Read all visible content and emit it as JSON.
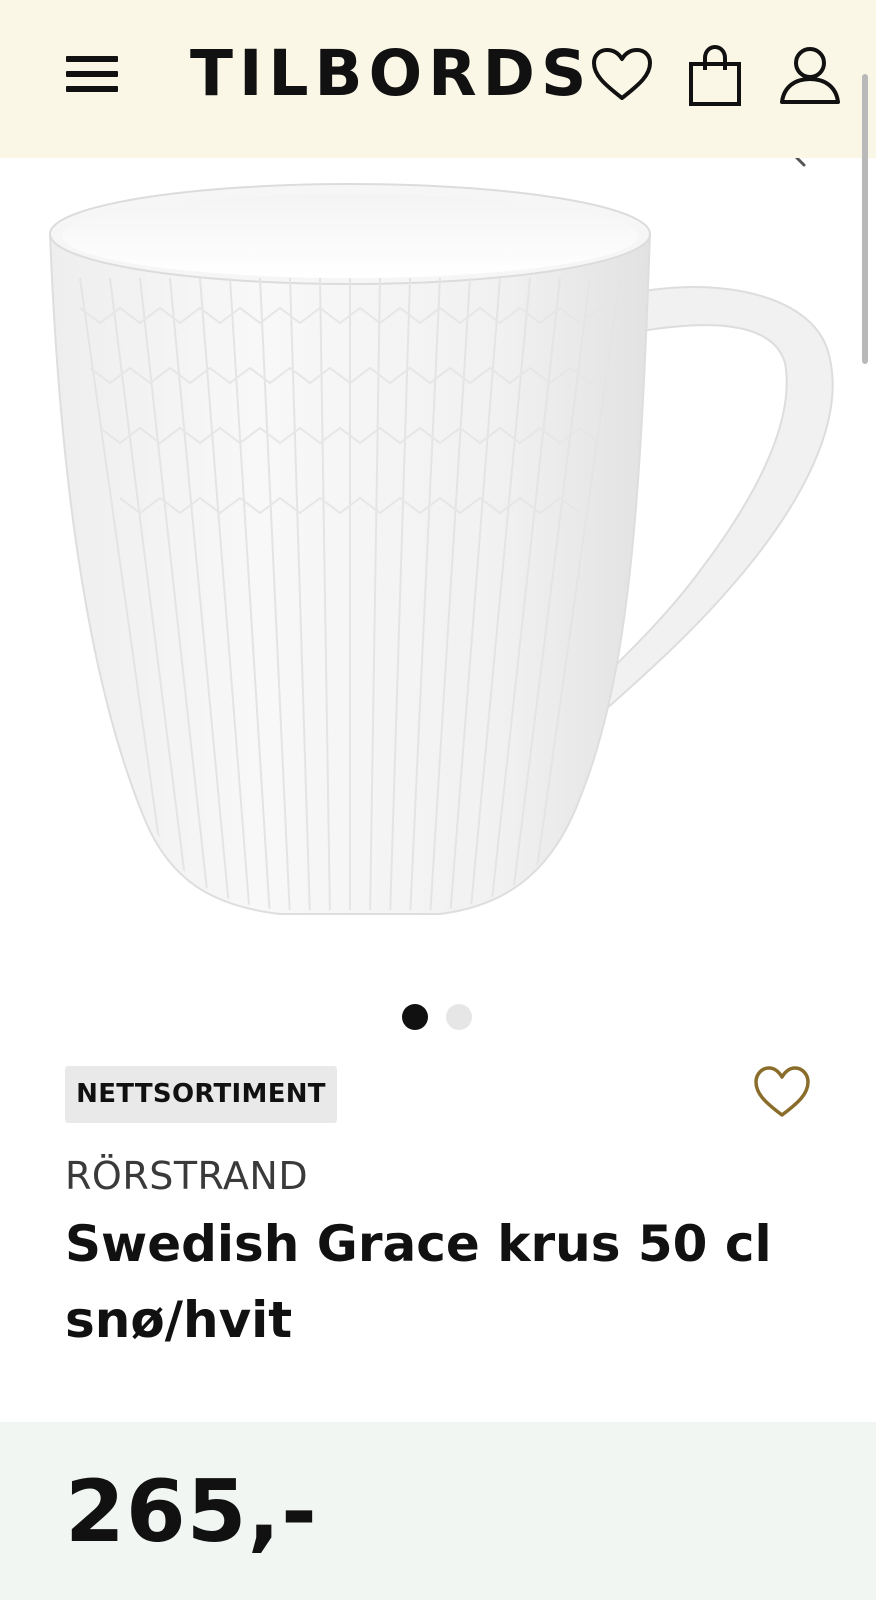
{
  "header": {
    "logo": "TILBORDS",
    "icons": {
      "menu": "hamburger-menu-icon",
      "wishlist": "heart-outline-icon",
      "cart": "shopping-bag-icon",
      "account": "user-icon"
    }
  },
  "gallery": {
    "image": "white-mug-photo",
    "zoom_icon": "magnifier-icon",
    "slides_total": 2,
    "active_slide": 1
  },
  "product": {
    "badge": "NETTSORTIMENT",
    "brand": "RÖRSTRAND",
    "title": "Swedish Grace krus 50 cl snø/hvit",
    "price": "265,-",
    "favorite_icon": "heart-outline-icon"
  },
  "colors": {
    "header_bg": "#fbf7e6",
    "badge_bg": "#e9e9e9",
    "heart_gold": "#8a6d2a",
    "price_panel_bg": "#f1f6f2",
    "text": "#111111"
  }
}
